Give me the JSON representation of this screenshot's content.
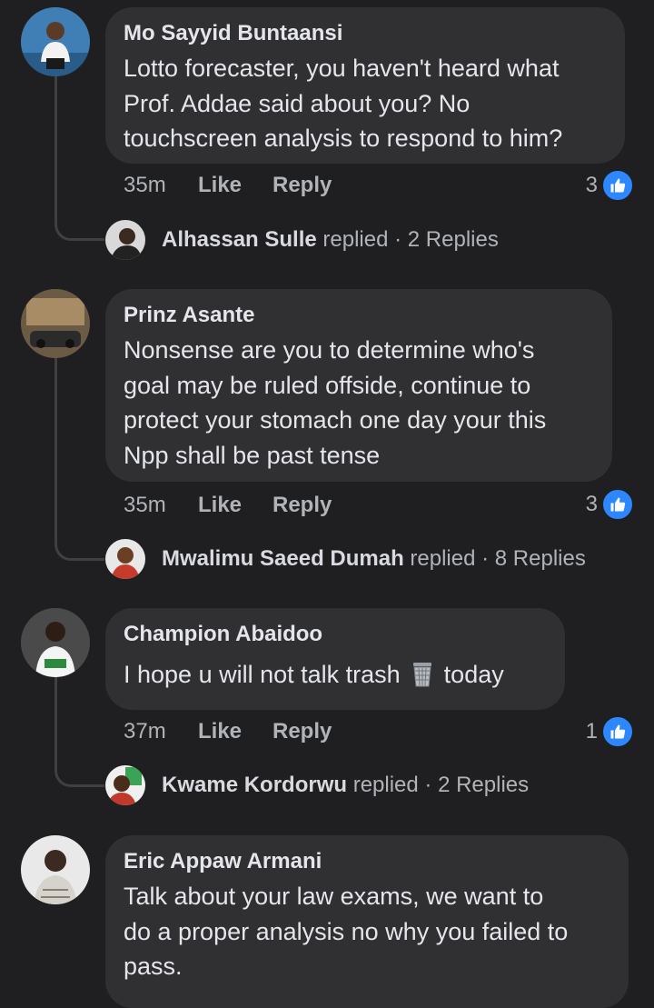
{
  "comments": [
    {
      "author": "Mo Sayyid Buntaansi",
      "lines": [
        "Lotto forecaster, you haven't heard what",
        "Prof. Addae said about you? No",
        "touchscreen analysis to respond to him?"
      ],
      "time": "35m",
      "like_label": "Like",
      "reply_label": "Reply",
      "reaction_count": "3",
      "replier": "Alhassan Sulle",
      "replied_label": "replied",
      "replies_text": "· 2 Replies"
    },
    {
      "author": "Prinz Asante",
      "lines": [
        "Nonsense are you to determine who's",
        "goal may be ruled offside, continue to",
        "protect your stomach one day your this",
        "Npp shall be past tense"
      ],
      "time": "35m",
      "like_label": "Like",
      "reply_label": "Reply",
      "reaction_count": "3",
      "replier": "Mwalimu Saeed Dumah",
      "replied_label": "replied",
      "replies_text": "· 8 Replies"
    },
    {
      "author": "Champion Abaidoo",
      "text_before": "I hope u will not talk trash",
      "text_after": "today",
      "time": "37m",
      "like_label": "Like",
      "reply_label": "Reply",
      "reaction_count": "1",
      "replier": "Kwame Kordorwu",
      "replied_label": "replied",
      "replies_text": "· 2 Replies"
    },
    {
      "author": "Eric Appaw Armani",
      "lines": [
        "Talk about your law exams, we want to",
        "do a proper analysis no why you failed to",
        "pass."
      ]
    }
  ],
  "icons": {
    "like_badge": "thumbs-up-icon",
    "emoji": "wastebasket-icon"
  },
  "colors": {
    "background": "#1f1f21",
    "bubble": "#303033",
    "like_blue": "#2d88ff",
    "secondary_text": "#b0b3b8"
  }
}
